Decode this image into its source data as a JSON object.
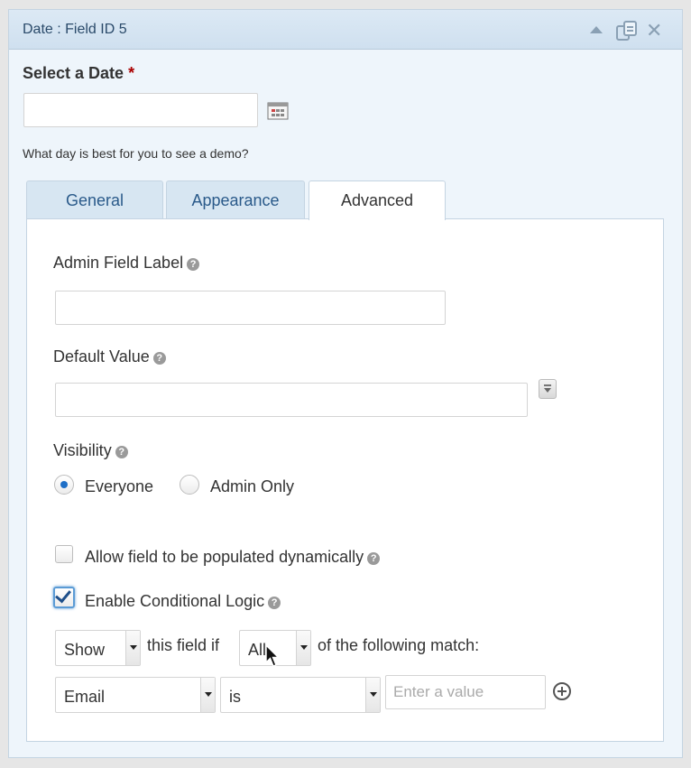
{
  "header": {
    "title": "Date : Field ID 5"
  },
  "field": {
    "label": "Select a Date",
    "required_mark": "*",
    "description": "What day is best for you to see a demo?"
  },
  "tabs": [
    {
      "label": "General",
      "active": false
    },
    {
      "label": "Appearance",
      "active": false
    },
    {
      "label": "Advanced",
      "active": true
    }
  ],
  "advanced": {
    "admin_label": "Admin Field Label",
    "default_value_label": "Default Value",
    "visibility_label": "Visibility",
    "visibility_options": [
      {
        "label": "Everyone",
        "checked": true
      },
      {
        "label": "Admin Only",
        "checked": false
      }
    ],
    "populate_dynamic": {
      "label": "Allow field to be populated dynamically",
      "checked": false
    },
    "conditional_logic": {
      "label": "Enable Conditional Logic",
      "checked": true
    }
  },
  "logic": {
    "action": "Show",
    "text_mid": "this field if",
    "match": "All",
    "text_end": "of the following match:",
    "rule_field": "Email",
    "rule_operator": "is",
    "rule_value_placeholder": "Enter a value"
  },
  "icons": {
    "collapse": "collapse-arrow-icon",
    "duplicate": "duplicate-icon",
    "close": "close-icon",
    "calendar": "calendar-icon",
    "help": "help-icon",
    "merge_tag": "merge-tag-icon",
    "add_rule": "add-rule-icon",
    "cursor": "mouse-cursor-icon"
  },
  "colors": {
    "header_bg": "#d5e5f2",
    "accent": "#1e6fc7",
    "required": "#aa0000",
    "tab_inactive_text": "#2a5a8a"
  }
}
